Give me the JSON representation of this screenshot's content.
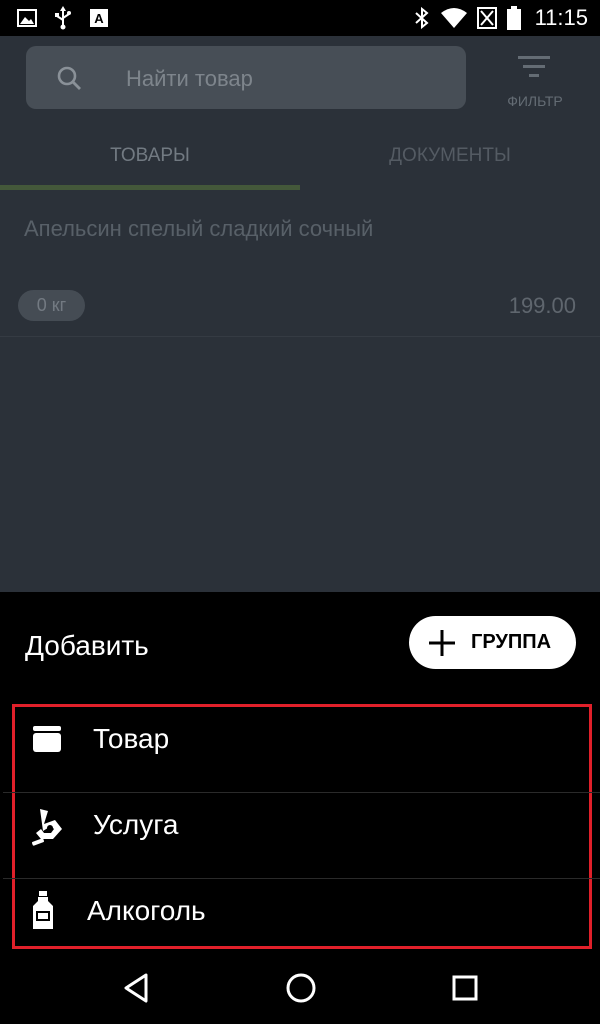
{
  "status_bar": {
    "time": "11:15",
    "icons_left": [
      "image-icon",
      "usb-icon",
      "font-icon"
    ],
    "icons_right": [
      "bluetooth-icon",
      "wifi-icon",
      "no-sim-icon",
      "battery-icon"
    ]
  },
  "search": {
    "placeholder": "Найти товар"
  },
  "filter": {
    "label": "ФИЛЬТР"
  },
  "tabs": [
    {
      "label": "ТОВАРЫ",
      "active": true
    },
    {
      "label": "ДОКУМЕНТЫ",
      "active": false
    }
  ],
  "products": [
    {
      "name": "Апельсин спелый сладкий сочный",
      "quantity": "0 кг",
      "price": "199.00"
    }
  ],
  "sheet": {
    "title": "Добавить",
    "group_button": "ГРУППА",
    "items": [
      {
        "label": "Товар",
        "icon": "product-box-icon"
      },
      {
        "label": "Услуга",
        "icon": "service-hand-icon"
      },
      {
        "label": "Алкоголь",
        "icon": "bottle-icon"
      }
    ]
  },
  "colors": {
    "highlight_border": "#e0202a",
    "tab_indicator": "#44583a"
  }
}
